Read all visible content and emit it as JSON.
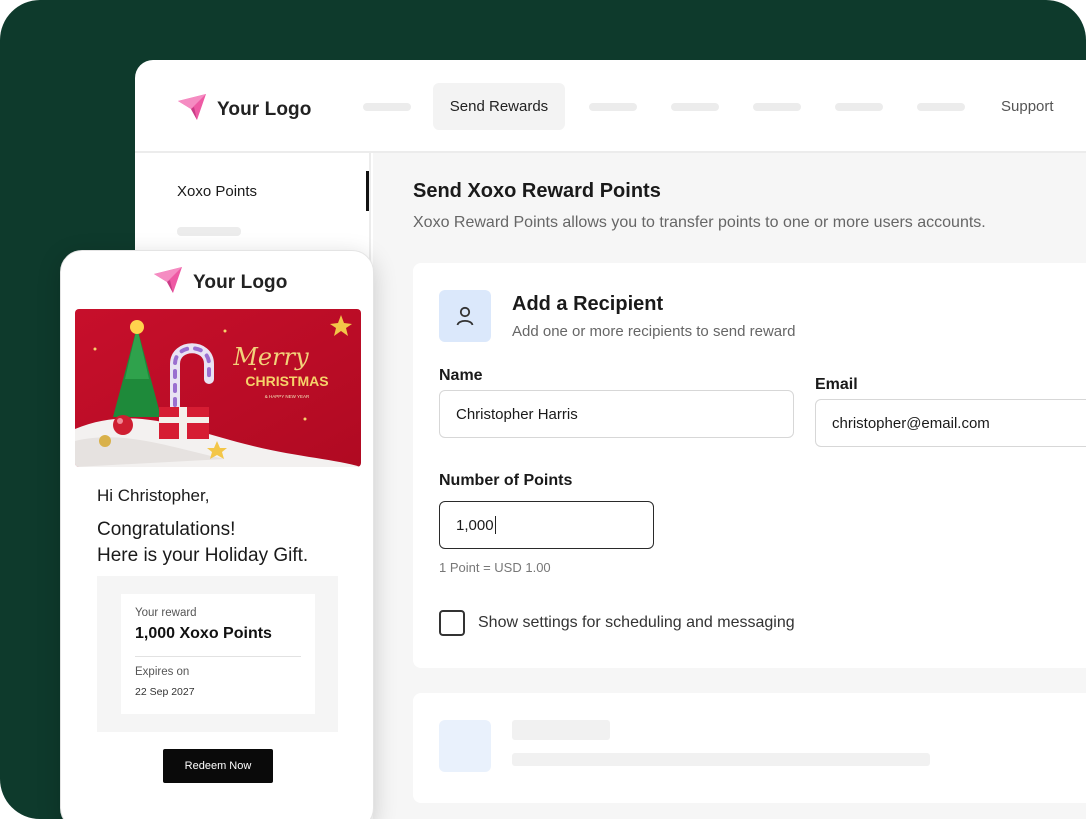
{
  "brand": {
    "logo_text": "Your Logo",
    "accent": "#ee5aa4",
    "background": "#0e3a2c"
  },
  "nav": {
    "active_label": "Send Rewards",
    "support_label": "Support"
  },
  "sidebar": {
    "active_item": "Xoxo Points"
  },
  "main": {
    "title": "Send Xoxo Reward Points",
    "subtitle": "Xoxo Reward Points allows you to transfer points to one or more users accounts."
  },
  "recipient": {
    "title": "Add a Recipient",
    "subtitle": "Add one or more recipients to send reward",
    "name_label": "Name",
    "name_value": "Christopher Harris",
    "email_label": "Email",
    "email_value": "christopher@email.com",
    "points_label": "Number of Points",
    "points_value": "1,000",
    "points_hint": "1 Point = USD 1.00",
    "schedule_label": "Show settings for scheduling and messaging",
    "schedule_checked": false
  },
  "email_preview": {
    "logo_text": "Your Logo",
    "banner_line1": "Merry",
    "banner_line2": "CHRISTMAS",
    "banner_line3": "& HAPPY NEW YEAR",
    "greeting": "Hi Christopher,",
    "congrats_line1": "Congratulations!",
    "congrats_line2": "Here is your Holiday Gift.",
    "reward_label": "Your reward",
    "reward_value": "1,000 Xoxo Points",
    "expires_label": "Expires on",
    "expires_value": "22 Sep 2027",
    "redeem_label": "Redeem Now"
  }
}
